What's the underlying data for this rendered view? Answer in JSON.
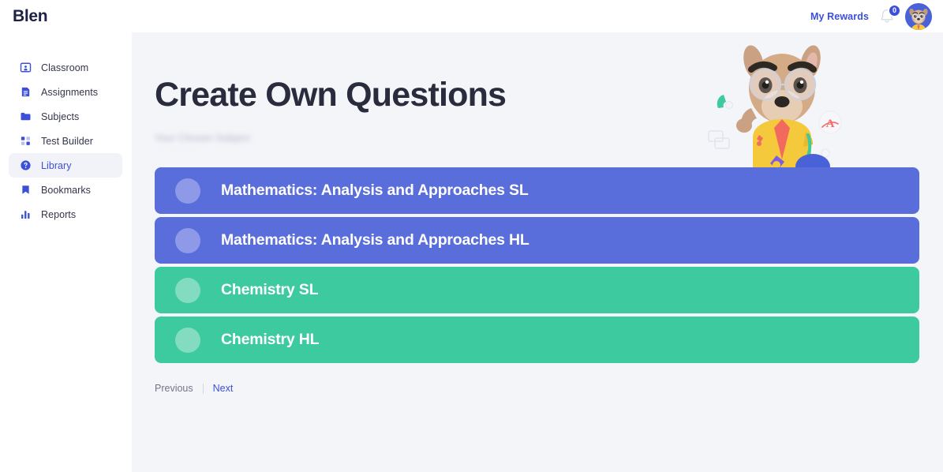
{
  "header": {
    "brand": "Blen",
    "rewards_label": "My Rewards",
    "notification_count": "0",
    "bell_icon": "bell-icon",
    "avatar_icon": "user-avatar-dog"
  },
  "sidebar": {
    "items": [
      {
        "label": "Classroom",
        "icon": "classroom-icon",
        "active": false
      },
      {
        "label": "Assignments",
        "icon": "assignments-icon",
        "active": false
      },
      {
        "label": "Subjects",
        "icon": "folder-icon",
        "active": false
      },
      {
        "label": "Test Builder",
        "icon": "grid-icon",
        "active": false
      },
      {
        "label": "Library",
        "icon": "question-circle-icon",
        "active": true
      },
      {
        "label": "Bookmarks",
        "icon": "bookmark-icon",
        "active": false
      },
      {
        "label": "Reports",
        "icon": "bar-chart-icon",
        "active": false
      }
    ]
  },
  "main": {
    "title": "Create Own Questions",
    "subtitle": "Your Chosen Subject",
    "mascot_icon": "dog-mascot-illustration",
    "subjects": [
      {
        "name": "Mathematics: Analysis and Approaches SL",
        "color": "#5a6edb",
        "theme": "blue"
      },
      {
        "name": "Mathematics: Analysis and Approaches HL",
        "color": "#5a6edb",
        "theme": "blue"
      },
      {
        "name": "Chemistry SL",
        "color": "#3cca9e",
        "theme": "green"
      },
      {
        "name": "Chemistry HL",
        "color": "#3cca9e",
        "theme": "green"
      }
    ],
    "pagination": {
      "previous": "Previous",
      "next": "Next"
    }
  },
  "colors": {
    "accent_blue": "#3b4fd8",
    "card_blue": "#5a6edb",
    "card_green": "#3cca9e",
    "page_background": "#f4f5f9",
    "title_text": "#2a2c3d"
  }
}
